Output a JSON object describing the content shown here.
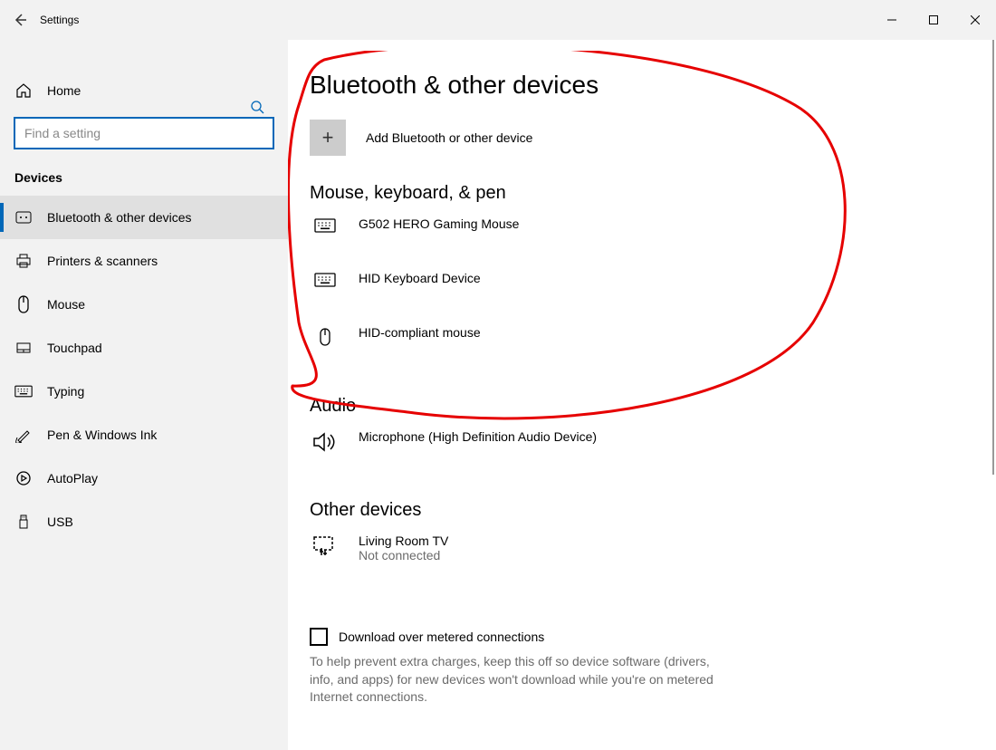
{
  "titlebar": {
    "label": "Settings"
  },
  "sidebar": {
    "home_label": "Home",
    "search_placeholder": "Find a setting",
    "category": "Devices",
    "items": [
      {
        "icon": "bluetooth",
        "label": "Bluetooth & other devices",
        "active": true
      },
      {
        "icon": "printer",
        "label": "Printers & scanners"
      },
      {
        "icon": "mouse",
        "label": "Mouse"
      },
      {
        "icon": "touchpad",
        "label": "Touchpad"
      },
      {
        "icon": "keyboard",
        "label": "Typing"
      },
      {
        "icon": "pen",
        "label": "Pen & Windows Ink"
      },
      {
        "icon": "autoplay",
        "label": "AutoPlay"
      },
      {
        "icon": "usb",
        "label": "USB"
      }
    ]
  },
  "page": {
    "title": "Bluetooth & other devices",
    "add_label": "Add Bluetooth or other device",
    "section1": {
      "title": "Mouse, keyboard, & pen",
      "devices": [
        {
          "icon": "keyboard",
          "name": "G502 HERO Gaming Mouse"
        },
        {
          "icon": "keyboard",
          "name": "HID Keyboard Device"
        },
        {
          "icon": "mouse",
          "name": "HID-compliant mouse"
        }
      ]
    },
    "section2": {
      "title": "Audio",
      "devices": [
        {
          "icon": "audio",
          "name": "Microphone (High Definition Audio Device)"
        }
      ]
    },
    "section3": {
      "title": "Other devices",
      "devices": [
        {
          "icon": "cast",
          "name": "Living Room TV",
          "status": "Not connected"
        }
      ]
    },
    "metered": {
      "label": "Download over metered connections",
      "help": "To help prevent extra charges, keep this off so device software (drivers, info, and apps) for new devices won't download while you're on metered Internet connections."
    }
  }
}
